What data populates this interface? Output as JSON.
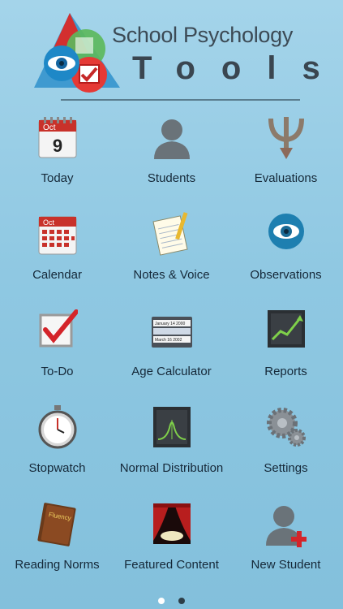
{
  "app": {
    "title_line1": "School Psychology",
    "title_line2": "Tools"
  },
  "tiles": [
    {
      "label": "Today",
      "icon": "calendar-today-icon",
      "month": "Oct",
      "day": "9"
    },
    {
      "label": "Students",
      "icon": "person-silhouette-icon"
    },
    {
      "label": "Evaluations",
      "icon": "psi-symbol-icon"
    },
    {
      "label": "Calendar",
      "icon": "calendar-month-icon",
      "month": "Oct"
    },
    {
      "label": "Notes & Voice",
      "icon": "notepad-pencil-icon"
    },
    {
      "label": "Observations",
      "icon": "eye-icon"
    },
    {
      "label": "To-Do",
      "icon": "checkbox-checked-icon"
    },
    {
      "label": "Age Calculator",
      "icon": "date-picker-icon",
      "rows": [
        "January 14 2000",
        "March 16 2002"
      ]
    },
    {
      "label": "Reports",
      "icon": "trend-chart-icon"
    },
    {
      "label": "Stopwatch",
      "icon": "stopwatch-icon"
    },
    {
      "label": "Normal Distribution",
      "icon": "bell-curve-icon"
    },
    {
      "label": "Settings",
      "icon": "gears-icon"
    },
    {
      "label": "Reading Norms",
      "icon": "fluency-book-icon",
      "book_text": "Fluency"
    },
    {
      "label": "Featured Content",
      "icon": "stage-curtain-icon"
    },
    {
      "label": "New Student",
      "icon": "add-person-icon"
    }
  ],
  "pager": {
    "page_count": 2,
    "current_page": 1
  },
  "colors": {
    "background": "#93cbe4",
    "label": "#152838",
    "accent_red": "#d4242a",
    "eye_blue": "#1e7fb0"
  }
}
